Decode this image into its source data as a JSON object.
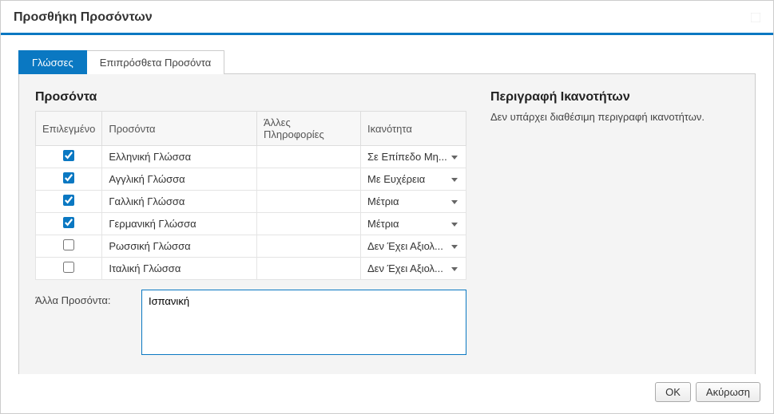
{
  "dialog": {
    "title": "Προσθήκη Προσόντων"
  },
  "tabs": {
    "languages": "Γλώσσες",
    "additional": "Επιπρόσθετα Προσόντα"
  },
  "left": {
    "section_title": "Προσόντα",
    "columns": {
      "selected": "Επιλεγμένο",
      "qualifications": "Προσόντα",
      "other_info": "Άλλες Πληροφορίες",
      "ability": "Ικανότητα"
    },
    "rows": [
      {
        "checked": true,
        "name": "Ελληνική Γλώσσα",
        "info": "",
        "ability": "Σε Επίπεδο Μη..."
      },
      {
        "checked": true,
        "name": "Αγγλική Γλώσσα",
        "info": "",
        "ability": "Με Ευχέρεια"
      },
      {
        "checked": true,
        "name": "Γαλλική Γλώσσα",
        "info": "",
        "ability": "Μέτρια"
      },
      {
        "checked": true,
        "name": "Γερμανική Γλώσσα",
        "info": "",
        "ability": "Μέτρια"
      },
      {
        "checked": false,
        "name": "Ρωσσική Γλώσσα",
        "info": "",
        "ability": "Δεν Έχει Αξιολ..."
      },
      {
        "checked": false,
        "name": "Ιταλική Γλώσσα",
        "info": "",
        "ability": "Δεν Έχει Αξιολ..."
      }
    ],
    "other_label": "Άλλα Προσόντα:",
    "other_value": "Ισπανική"
  },
  "right": {
    "section_title": "Περιγραφή Ικανοτήτων",
    "description": "Δεν υπάρχει διαθέσιμη περιγραφή ικανοτήτων."
  },
  "footer": {
    "ok": "OK",
    "cancel": "Ακύρωση"
  }
}
